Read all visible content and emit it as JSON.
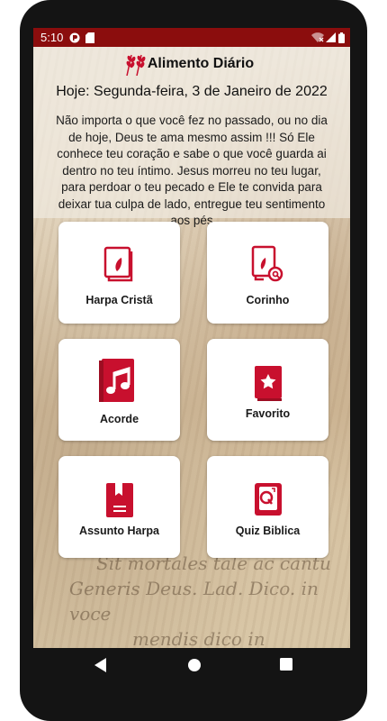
{
  "status_bar": {
    "time": "5:10"
  },
  "app": {
    "title": "Alimento Diário",
    "date": "Hoje: Segunda-feira, 3 de Janeiro de 2022",
    "message": "Não importa o que você fez no passado, ou no dia de hoje, Deus te ama mesmo assim !!! Só Ele conhece teu coração e sabe o que você guarda ai dentro no teu íntimo. Jesus morreu no teu lugar, para perdoar o teu pecado e Ele te convida para deixar tua culpa de lado, entregue teu sentimento aos pés"
  },
  "menu": [
    {
      "label": "Harpa Cristã",
      "icon": "book-leaf-icon"
    },
    {
      "label": "Corinho",
      "icon": "book-search-icon"
    },
    {
      "label": "Acorde",
      "icon": "music-book-icon"
    },
    {
      "label": "Favorito",
      "icon": "star-book-icon"
    },
    {
      "label": "Assunto Harpa",
      "icon": "bookmark-book-icon"
    },
    {
      "label": "Quiz Biblica",
      "icon": "quiz-icon"
    }
  ],
  "colors": {
    "accent": "#c8102e",
    "status_bar": "#8b0d0d"
  }
}
